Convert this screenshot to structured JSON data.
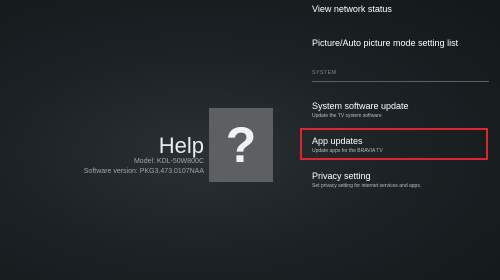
{
  "help": {
    "title": "Help",
    "model": "Model: KDL-50W800C",
    "software_version": "Software version: PKG3.473.0107NAA",
    "icon": "question-mark-icon",
    "icon_glyph": "?"
  },
  "menu": {
    "network_status": {
      "label": "View network status"
    },
    "picture_mode": {
      "label": "Picture/Auto picture mode setting list"
    },
    "section_header": "SYSTEM",
    "system_update": {
      "label": "System software update",
      "sub": "Update the TV system software"
    },
    "app_updates": {
      "label": "App updates",
      "sub": "Update apps for the BRAVIA TV"
    },
    "privacy": {
      "label": "Privacy setting",
      "sub": "Set privacy setting for internet services and apps."
    }
  },
  "colors": {
    "highlight": "#e0242b",
    "background": "#1c2225",
    "icon_tile": "#5c6063"
  }
}
